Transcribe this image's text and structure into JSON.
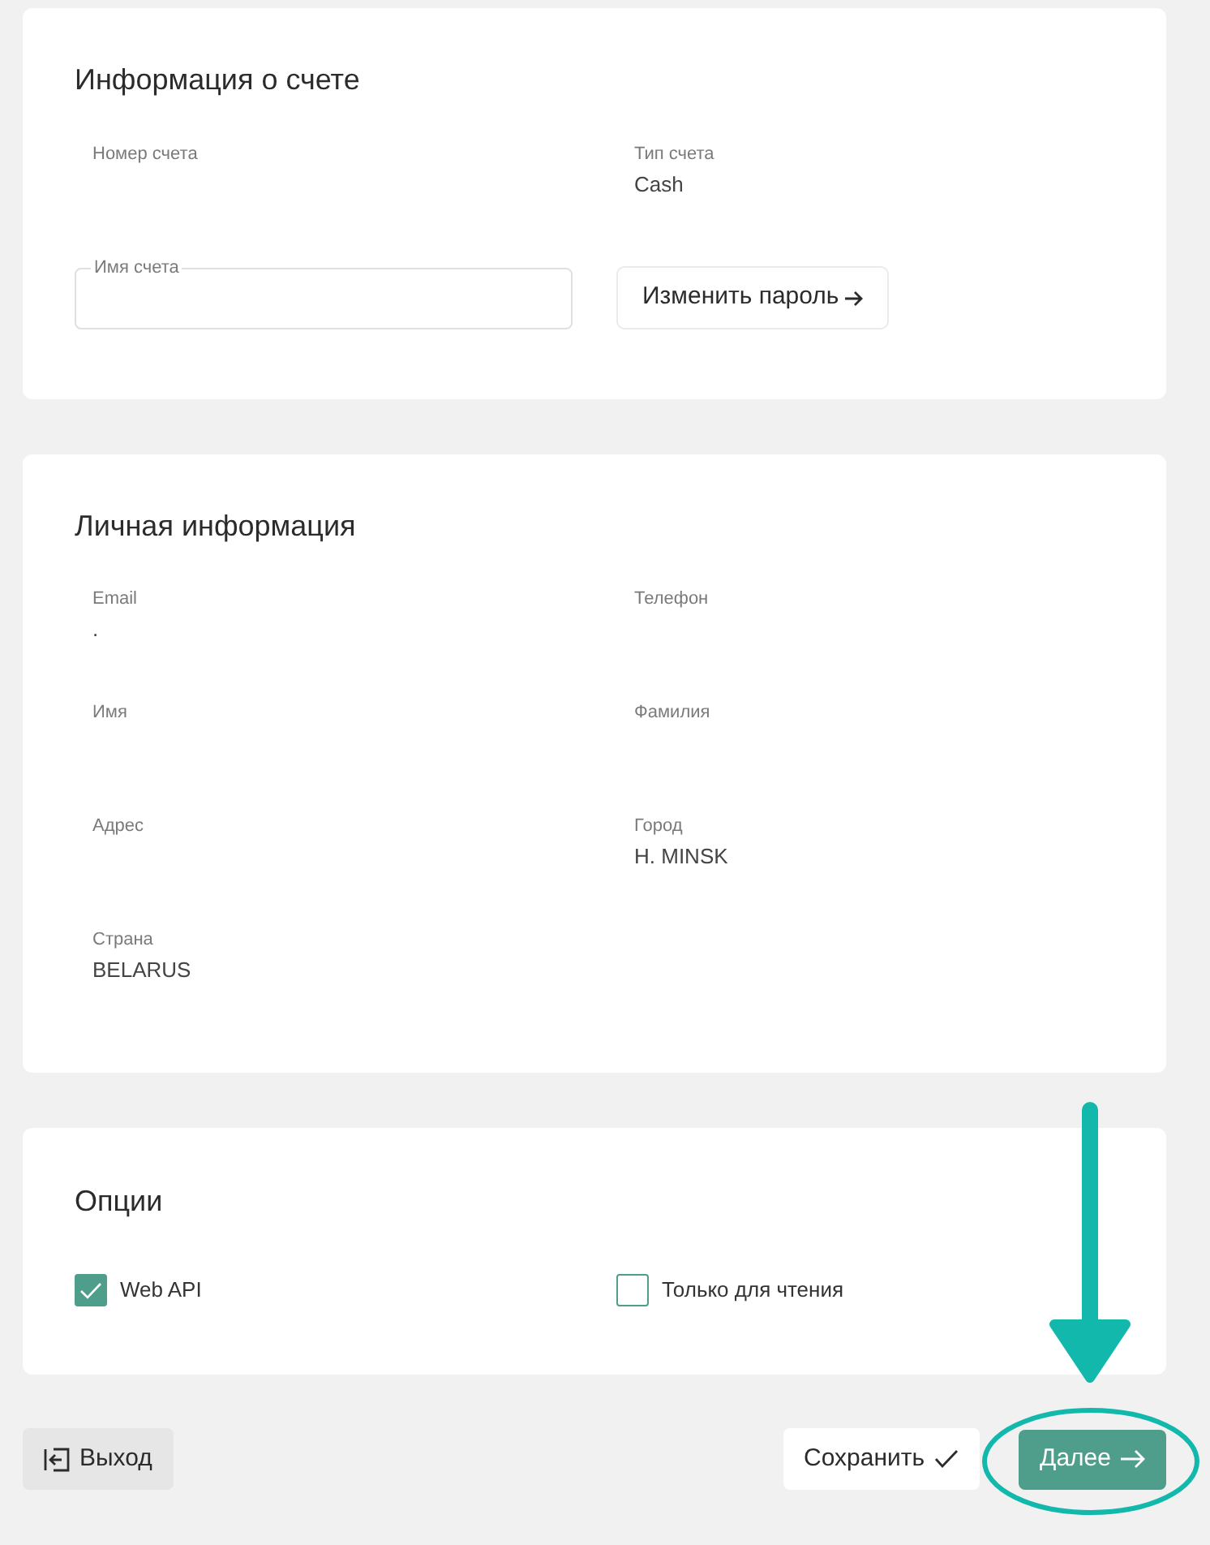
{
  "account_info": {
    "title": "Информация о счете",
    "fields": [
      {
        "label": "Номер счета"
      },
      {
        "label": "Тип счета",
        "value": "Cash"
      }
    ],
    "name_field": {
      "label": "Имя счета"
    },
    "change_password_button": {
      "label": "Изменить пароль"
    }
  },
  "personal_info": {
    "title": "Личная информация",
    "fields": [
      {
        "label": "Email",
        "value": "."
      },
      {
        "label": "Телефон"
      },
      {
        "label": "Имя"
      },
      {
        "label": "Фамилия"
      },
      {
        "label": "Адрес"
      },
      {
        "label": "Город",
        "value": "H. MINSK"
      },
      {
        "label": "Страна",
        "value": "BELARUS"
      }
    ]
  },
  "options": {
    "title": "Опции",
    "checkboxes": [
      {
        "label": "Web API",
        "checked": true
      },
      {
        "label": "Только для чтения",
        "checked": false
      }
    ]
  },
  "footer": {
    "exit_button": "Выход",
    "save_button": "Сохранить",
    "next_button": "Далее"
  }
}
